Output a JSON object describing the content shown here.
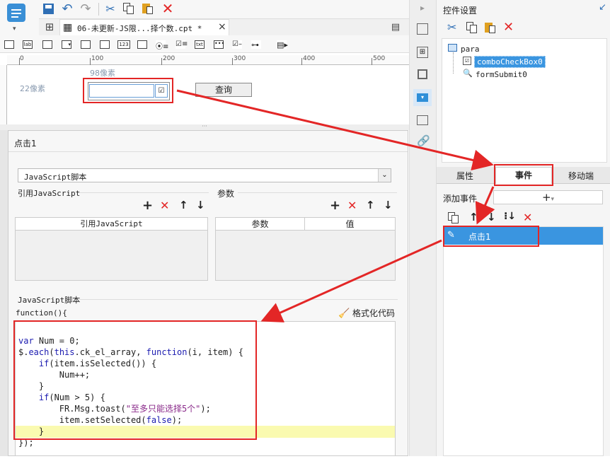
{
  "toolbar": {
    "tab_title": "06-未更新-JS限...择个数.cpt *",
    "tab_close": "×"
  },
  "ruler": {
    "ticks": [
      "0",
      "100",
      "200",
      "300",
      "400",
      "500"
    ]
  },
  "canvas": {
    "width_label": "98像素",
    "height_label": "22像素",
    "query_button": "查询"
  },
  "event_editor": {
    "title": "点击1",
    "type_select": "JavaScript脚本",
    "ref_js_label": "引用JavaScript",
    "params_label": "参数",
    "ref_js_column": "引用JavaScript",
    "param_column": "参数",
    "value_column": "值",
    "script_label": "JavaScript脚本",
    "function_header": "function(){",
    "format_code": "格式化代码",
    "code_lines": [
      "var Num = 0;",
      "$.each(this.ck_el_array, function(i, item) {",
      "    if(item.isSelected()) {",
      "        Num++;",
      "    }",
      "    if(Num > 5) {",
      "        FR.Msg.toast(\"至多只能选择5个\");",
      "        item.setSelected(false);",
      "    }",
      "});"
    ]
  },
  "right_panel": {
    "title": "控件设置",
    "tree": {
      "root": "para",
      "children": [
        "comboCheckBox0",
        "formSubmit0"
      ]
    },
    "tabs": [
      "属性",
      "事件",
      "移动端"
    ],
    "add_event_label": "添加事件",
    "events": [
      "点击1"
    ]
  },
  "colors": {
    "accent": "#2f8fd8",
    "highlight_red": "#e32626",
    "selected_blue": "#3a95e0",
    "code_highlight": "#fafab0"
  }
}
